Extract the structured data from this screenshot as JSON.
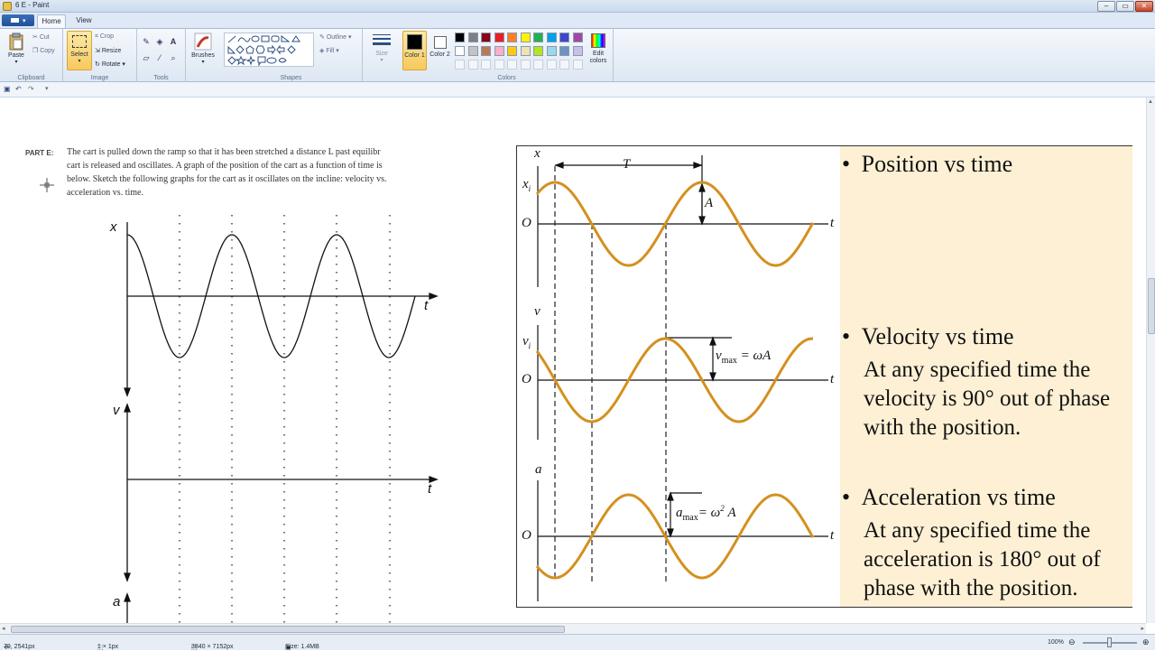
{
  "window": {
    "title": "6 E - Paint",
    "controls": [
      "–",
      "▭",
      "✕"
    ]
  },
  "tabs": [
    "Home",
    "View"
  ],
  "ribbon": {
    "clipboard": {
      "label": "Clipboard",
      "paste": "Paste",
      "cut": "Cut",
      "copy": "Copy"
    },
    "image": {
      "label": "Image",
      "select": "Select",
      "crop": "Crop",
      "resize": "Resize",
      "rotate": "Rotate"
    },
    "tools": {
      "label": "Tools"
    },
    "brushes": {
      "label": "Brushes"
    },
    "shapes": {
      "label": "Shapes",
      "outline": "Outline",
      "fill": "Fill"
    },
    "size": {
      "label": "Size"
    },
    "colors": {
      "label": "Colors",
      "color1": "Color 1",
      "color2": "Color 2",
      "edit": "Edit colors",
      "palette_row1": [
        "#000000",
        "#7f7f7f",
        "#880015",
        "#ed1c24",
        "#ff7f27",
        "#fff200",
        "#22b14c",
        "#00a2e8",
        "#3f48cc",
        "#a349a4"
      ],
      "palette_row2": [
        "#ffffff",
        "#c3c3c3",
        "#b97a57",
        "#ffaec9",
        "#ffc90e",
        "#efe4b0",
        "#b5e61d",
        "#99d9ea",
        "#7092be",
        "#c8bfe7"
      ]
    }
  },
  "document": {
    "part_label": "PART E:",
    "lines": [
      "The cart is pulled down the ramp so that it has been stretched a distance L past equilibr",
      "cart is released and oscillates. A graph of the position of the cart as a function of time is",
      "below. Sketch the following graphs for the cart as it oscillates on the incline: velocity vs.",
      "acceleration vs. time."
    ],
    "graph_labels": {
      "x": "x",
      "v": "v",
      "a": "a",
      "t1": "t",
      "t2": "t"
    }
  },
  "panel": {
    "labels": {
      "x": "x",
      "xi": "x",
      "xi_sub": "i",
      "O1": "O",
      "t1": "t",
      "T": "T",
      "A": "A",
      "v": "v",
      "vi": "v",
      "vi_sub": "i",
      "O2": "O",
      "t2": "t",
      "vmax": "v",
      "vmax_sub": "max",
      "vmax_eq": "= ωA",
      "a": "a",
      "O3": "O",
      "t3": "t",
      "amax": "a",
      "amax_sub": "max",
      "amax_eq": "= ω",
      "amax_sup": "2",
      "amax_A": "A"
    },
    "notes": {
      "b1": "Position vs time",
      "b2": "Velocity vs time",
      "b2_text": [
        "At any specified time the",
        "velocity is 90° out of phase",
        "with the position."
      ],
      "b3": "Acceleration vs time",
      "b3_text": [
        "At any specified time the",
        "acceleration is 180° out of",
        "phase with the position."
      ]
    }
  },
  "status": {
    "cursor": "79, 2541px",
    "selection": "1 × 1px",
    "dimensions": "3840 × 7152px",
    "size": "Size: 1.4MB",
    "zoom": "100%"
  }
}
